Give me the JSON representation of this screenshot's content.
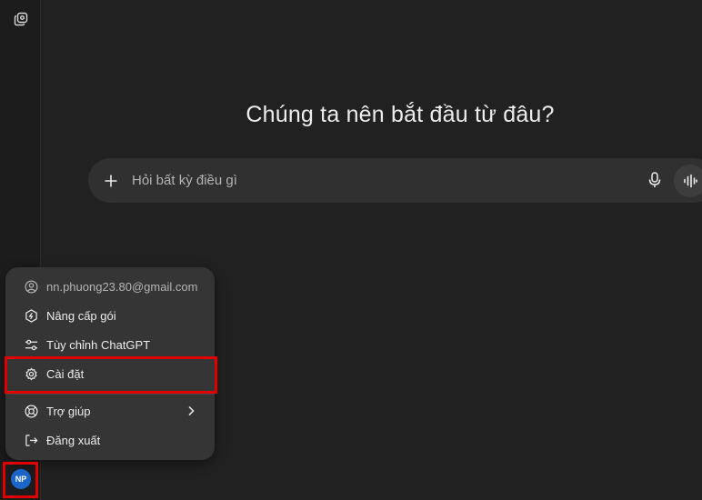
{
  "main": {
    "heading": "Chúng ta nên bắt đầu từ đâu?"
  },
  "composer": {
    "placeholder": "Hỏi bất kỳ điều gì"
  },
  "account_menu": {
    "email": "nn.phuong23.80@gmail.com",
    "items": [
      {
        "label": "Nâng cấp gói",
        "icon": "upgrade-icon"
      },
      {
        "label": "Tùy chỉnh ChatGPT",
        "icon": "sliders-icon"
      },
      {
        "label": "Cài đặt",
        "icon": "gear-icon"
      },
      {
        "label": "Trợ giúp",
        "icon": "lifebuoy-icon"
      },
      {
        "label": "Đăng xuất",
        "icon": "logout-icon"
      }
    ]
  },
  "user": {
    "initials": "NP",
    "avatar_color": "#1b65c8"
  },
  "colors": {
    "background": "#212121",
    "menu": "#353535",
    "composer": "#303030",
    "highlight": "#e00000"
  }
}
